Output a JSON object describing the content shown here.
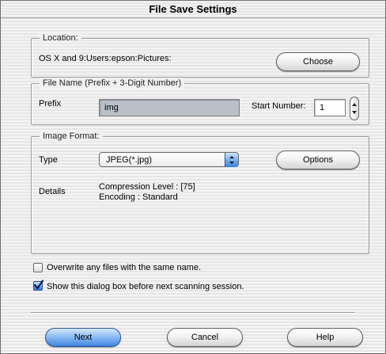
{
  "window": {
    "title": "File Save Settings"
  },
  "location": {
    "legend": "Location:",
    "path": "OS X and 9:Users:epson:Pictures:",
    "choose_label": "Choose"
  },
  "filename": {
    "legend": "File Name (Prefix + 3-Digit Number)",
    "prefix_label": "Prefix",
    "prefix_value": "img",
    "start_label": "Start Number:",
    "start_value": "1"
  },
  "image_format": {
    "legend": "Image Format:",
    "type_label": "Type",
    "type_value": "JPEG(*.jpg)",
    "options_label": "Options",
    "details_label": "Details",
    "details_line1": "Compression Level : [75]",
    "details_line2": "Encoding : Standard"
  },
  "checkboxes": [
    {
      "label": "Overwrite any files with the same name.",
      "checked": false
    },
    {
      "label": "Show this dialog box before next scanning session.",
      "checked": true
    }
  ],
  "buttons": {
    "next": "Next",
    "cancel": "Cancel",
    "help": "Help"
  },
  "colors": {
    "accent": "#3f86de",
    "window_bg": "#ececec"
  },
  "icons": {
    "checkmark": "checkmark-icon",
    "popup_arrows": "popup-arrows-icon",
    "stepper": "stepper-arrows-icon"
  }
}
